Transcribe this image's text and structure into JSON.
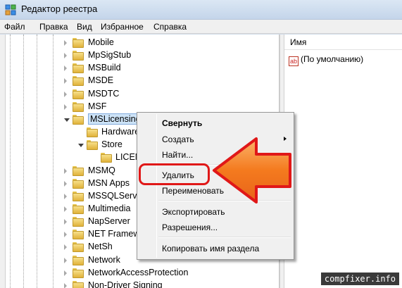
{
  "window": {
    "title": "Редактор реестра"
  },
  "menubar": [
    "Файл",
    "Правка",
    "Вид",
    "Избранное",
    "Справка"
  ],
  "tree": [
    {
      "label": "Mobile",
      "state": "collapsed"
    },
    {
      "label": "MpSigStub",
      "state": "collapsed"
    },
    {
      "label": "MSBuild",
      "state": "collapsed"
    },
    {
      "label": "MSDE",
      "state": "collapsed"
    },
    {
      "label": "MSDTC",
      "state": "collapsed"
    },
    {
      "label": "MSF",
      "state": "collapsed"
    },
    {
      "label": "MSLicensing",
      "state": "expanded",
      "selected": true
    },
    {
      "label": "Hardware",
      "state": "none",
      "child": true
    },
    {
      "label": "Store",
      "state": "expanded",
      "child": true
    },
    {
      "label": "LICEN",
      "state": "none",
      "grandchild": true
    },
    {
      "label": "MSMQ",
      "state": "collapsed"
    },
    {
      "label": "MSN Apps",
      "state": "collapsed"
    },
    {
      "label": "MSSQLServer",
      "state": "collapsed"
    },
    {
      "label": "Multimedia",
      "state": "collapsed"
    },
    {
      "label": "NapServer",
      "state": "collapsed"
    },
    {
      "label": "NET Framew",
      "state": "collapsed"
    },
    {
      "label": "NetSh",
      "state": "collapsed"
    },
    {
      "label": "Network",
      "state": "collapsed"
    },
    {
      "label": "NetworkAccessProtection",
      "state": "collapsed"
    },
    {
      "label": "Non-Driver Signing",
      "state": "collapsed"
    }
  ],
  "right_pane": {
    "column_name": "Имя",
    "default_value": "(По умолчанию)",
    "value_icon": "ab"
  },
  "context_menu": {
    "items": [
      {
        "label": "Свернуть",
        "bold": true
      },
      {
        "label": "Создать",
        "submenu": true
      },
      {
        "label": "Найти..."
      },
      {
        "label": "Удалить",
        "highlighted": true
      },
      {
        "label": "Переименовать"
      },
      {
        "label": "Экспортировать"
      },
      {
        "label": "Разрешения..."
      },
      {
        "label": "Копировать имя раздела"
      }
    ]
  },
  "colors": {
    "annotation_red": "#e01818",
    "arrow_orange": "#f47a1e",
    "selection": "#cde3f7"
  },
  "watermark": "compfixer.info"
}
